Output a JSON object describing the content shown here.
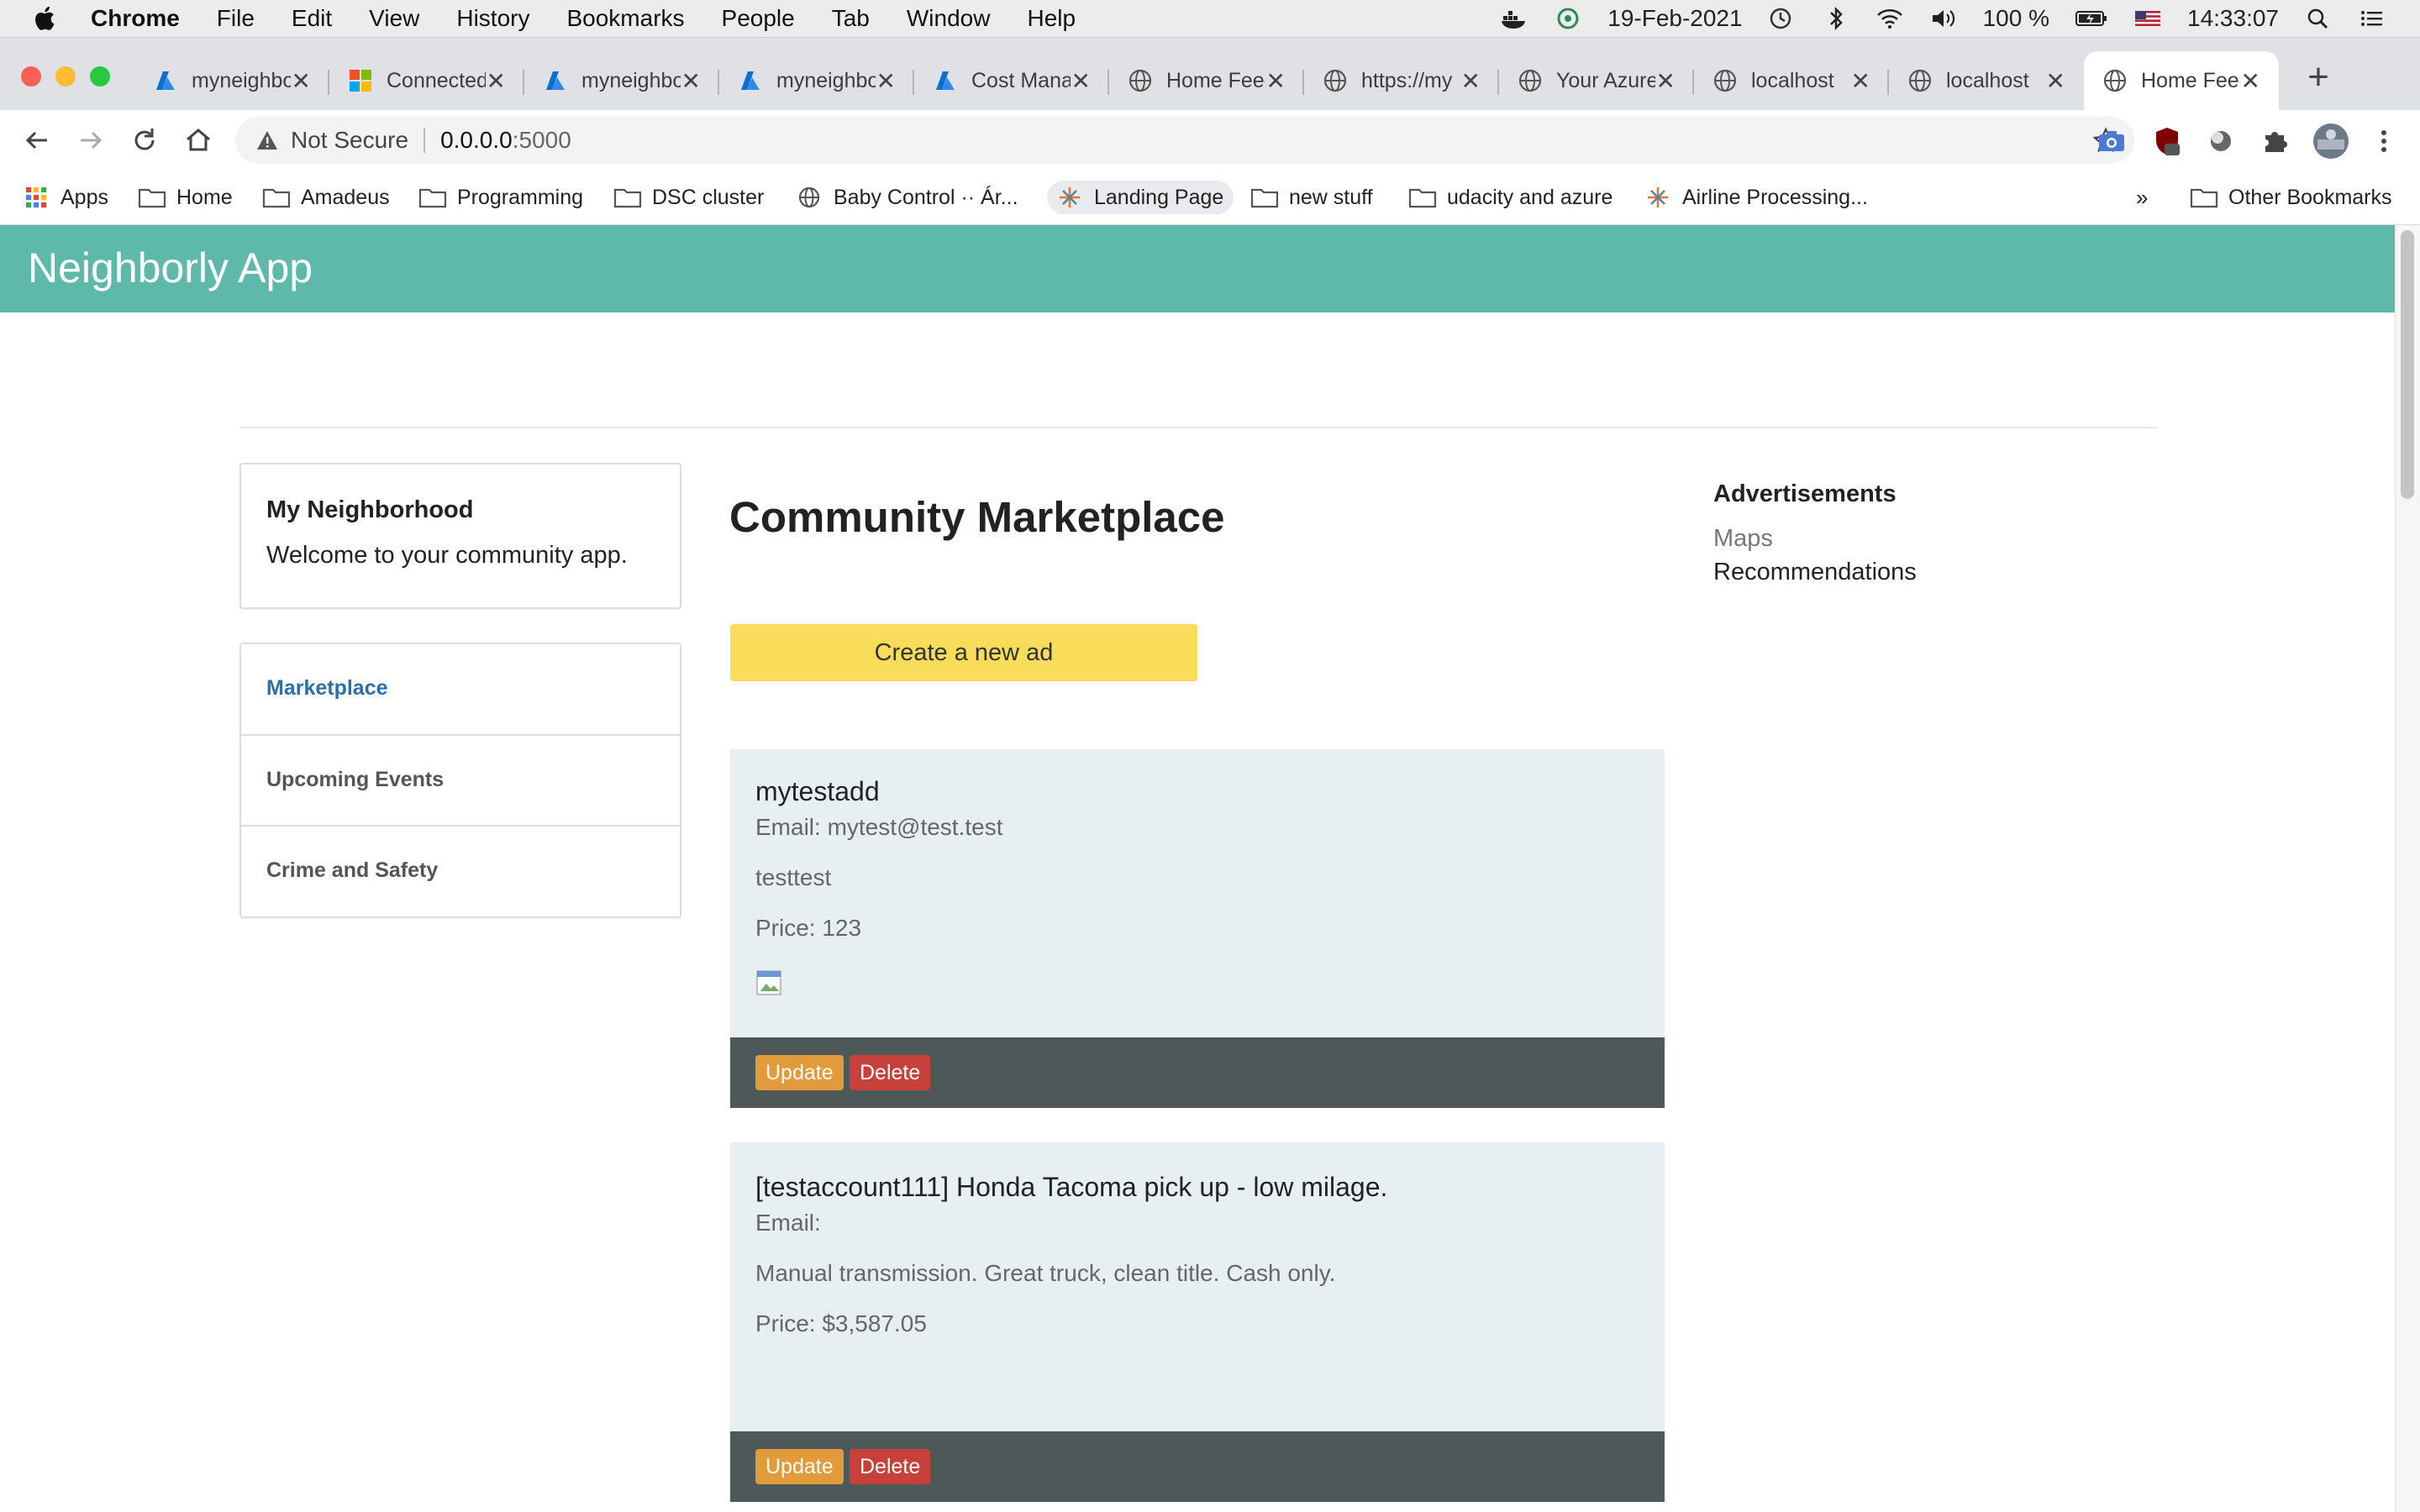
{
  "menubar": {
    "app": "Chrome",
    "items": [
      "File",
      "Edit",
      "View",
      "History",
      "Bookmarks",
      "People",
      "Tab",
      "Window",
      "Help"
    ],
    "date": "19-Feb-2021",
    "battery": "100 %",
    "time": "14:33:07"
  },
  "tabs": [
    {
      "title": "myneighborly",
      "icon": "azure-icon"
    },
    {
      "title": "Connected",
      "icon": "microsoft-icon"
    },
    {
      "title": "myneighborly",
      "icon": "azure-icon"
    },
    {
      "title": "myneighborly",
      "icon": "azure-icon"
    },
    {
      "title": "Cost Management",
      "icon": "azure-icon"
    },
    {
      "title": "Home Feed",
      "icon": "globe-icon"
    },
    {
      "title": "https://my",
      "icon": "globe-icon"
    },
    {
      "title": "Your Azure",
      "icon": "globe-icon"
    },
    {
      "title": "localhost",
      "icon": "globe-icon"
    },
    {
      "title": "localhost",
      "icon": "globe-icon"
    },
    {
      "title": "Home Feed",
      "icon": "globe-icon",
      "active": true
    }
  ],
  "omnibox": {
    "security": "Not Secure",
    "host": "0.0.0.0",
    "port": ":5000"
  },
  "bookmarks": [
    {
      "label": "Apps",
      "icon": "apps-grid-icon"
    },
    {
      "label": "Home",
      "icon": "folder-icon"
    },
    {
      "label": "Amadeus",
      "icon": "folder-icon"
    },
    {
      "label": "Programming",
      "icon": "folder-icon"
    },
    {
      "label": "DSC cluster",
      "icon": "folder-icon"
    },
    {
      "label": "Baby Control ·· Ár...",
      "icon": "globe-icon"
    },
    {
      "label": "Landing Page",
      "icon": "tableau-icon"
    },
    {
      "label": "new stuff",
      "icon": "folder-icon"
    },
    {
      "label": "udacity and azure",
      "icon": "folder-icon"
    },
    {
      "label": "Airline Processing...",
      "icon": "tableau-icon"
    }
  ],
  "bookmarks_overflow": "»",
  "other_bookmarks": "Other Bookmarks",
  "app": {
    "title": "Neighborly App",
    "sidebar": {
      "title": "My Neighborhood",
      "welcome": "Welcome to your community app.",
      "nav": [
        "Marketplace",
        "Upcoming Events",
        "Crime and Safety"
      ]
    },
    "main": {
      "heading": "Community Marketplace",
      "create_label": "Create a new ad",
      "ads": [
        {
          "title": "mytestadd",
          "email": "Email: mytest@test.test",
          "description": "testtest",
          "price": "Price: 123"
        },
        {
          "title": "[testaccount111] Honda Tacoma pick up - low milage.",
          "email": "Email:",
          "description": "Manual transmission. Great truck, clean title. Cash only.",
          "price": "Price: $3,587.05"
        }
      ],
      "update_label": "Update",
      "delete_label": "Delete"
    },
    "right": {
      "title": "Advertisements",
      "links": [
        "Maps",
        "Recommendations"
      ]
    }
  },
  "colors": {
    "app_bar": "#5eb9aa",
    "create_button": "#f8dc5a",
    "update_button": "#e29b3a",
    "delete_button": "#c8403a",
    "card_bg": "#e8eff3",
    "card_footer": "#4f5859",
    "active_nav": "#2a6fa8"
  }
}
